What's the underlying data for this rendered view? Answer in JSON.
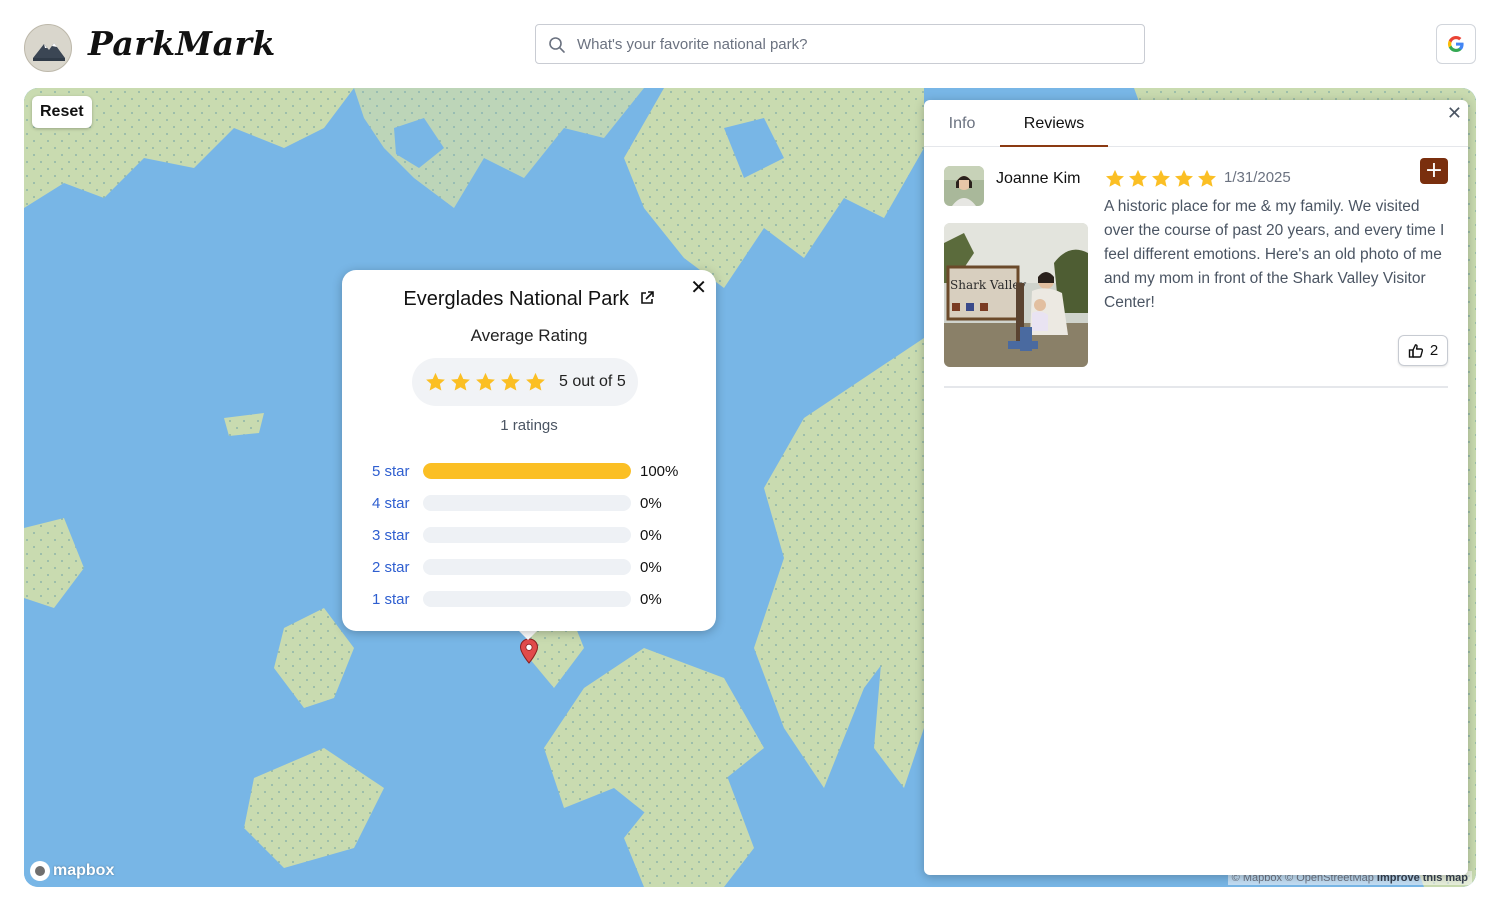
{
  "app": {
    "brand": "ParkMark"
  },
  "search": {
    "placeholder": "What's your favorite national park?"
  },
  "map": {
    "reset_label": "Reset",
    "logo_text": "mapbox",
    "attribution": {
      "mapbox": "© Mapbox",
      "osm": "© OpenStreetMap",
      "improve": "Improve this map"
    }
  },
  "popup": {
    "park_name": "Everglades National Park",
    "average_label": "Average Rating",
    "average_text": "5 out of 5",
    "average_rating": 5,
    "ratings_count": "1 ratings",
    "distribution": [
      {
        "label": "5 star",
        "pct": "100%",
        "fraction": 1.0
      },
      {
        "label": "4 star",
        "pct": "0%",
        "fraction": 0
      },
      {
        "label": "3 star",
        "pct": "0%",
        "fraction": 0
      },
      {
        "label": "2 star",
        "pct": "0%",
        "fraction": 0
      },
      {
        "label": "1 star",
        "pct": "0%",
        "fraction": 0
      }
    ]
  },
  "panel": {
    "tabs": [
      {
        "label": "Info"
      },
      {
        "label": "Reviews"
      }
    ],
    "active_tab": "Reviews",
    "reviews": [
      {
        "author": "Joanne Kim",
        "rating": 5,
        "date": "1/31/2025",
        "text": "A historic place for me & my family. We visited over the course of past 20 years, and every time I feel different emotions. Here's an old photo of me and my mom in front of the Shark Valley Visitor Center!",
        "likes": "2",
        "photo_sign_text": "Shark Valley"
      }
    ]
  },
  "colors": {
    "accent": "#7a2f0e",
    "star": "#fbbf24",
    "water": "#78b6e6",
    "land": "#c9dbb0",
    "link": "#2f5fd0"
  }
}
